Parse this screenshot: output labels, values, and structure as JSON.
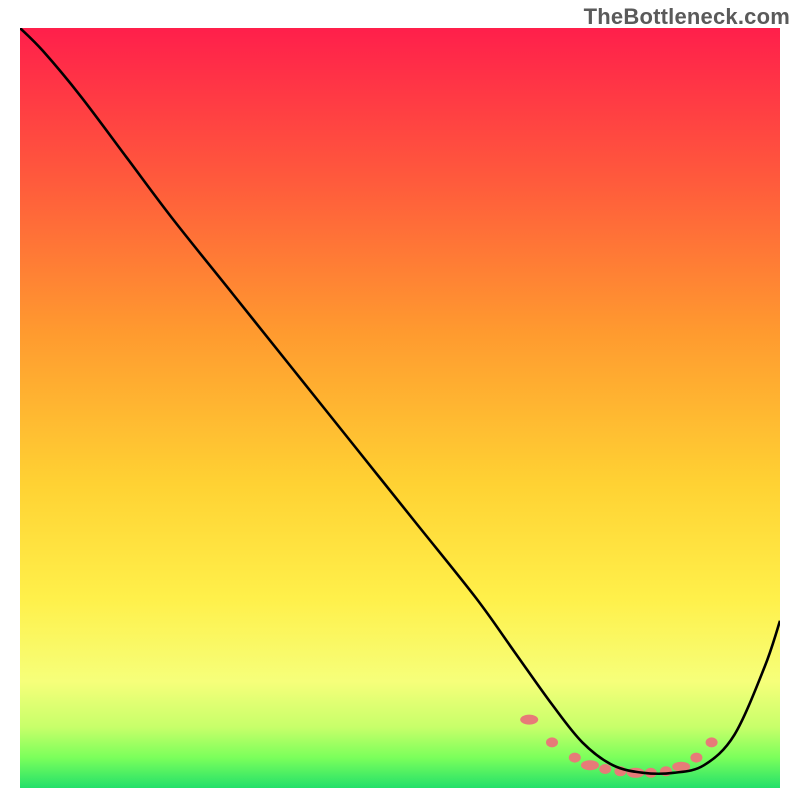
{
  "watermark": "TheBottleneck.com",
  "chart_data": {
    "type": "line",
    "title": "",
    "xlabel": "",
    "ylabel": "",
    "xlim": [
      0,
      100
    ],
    "ylim": [
      0,
      100
    ],
    "grid": false,
    "legend": false,
    "gradient_stops": [
      {
        "offset": 0,
        "color": "#ff1f4b"
      },
      {
        "offset": 20,
        "color": "#ff5a3c"
      },
      {
        "offset": 40,
        "color": "#ff9a2f"
      },
      {
        "offset": 60,
        "color": "#ffd233"
      },
      {
        "offset": 75,
        "color": "#fff04a"
      },
      {
        "offset": 86,
        "color": "#f6ff7a"
      },
      {
        "offset": 92,
        "color": "#c7ff6a"
      },
      {
        "offset": 96,
        "color": "#7bff5b"
      },
      {
        "offset": 100,
        "color": "#23e06a"
      }
    ],
    "series": [
      {
        "name": "bottleneck-curve",
        "color": "#000000",
        "x": [
          0,
          3,
          8,
          14,
          20,
          28,
          36,
          44,
          52,
          60,
          65,
          70,
          74,
          78,
          82,
          86,
          90,
          94,
          98,
          100
        ],
        "y": [
          100,
          97,
          91,
          83,
          75,
          65,
          55,
          45,
          35,
          25,
          18,
          11,
          6,
          3,
          2,
          2,
          3,
          7,
          16,
          22
        ]
      }
    ],
    "markers": {
      "name": "optimal-range",
      "color": "#e77b78",
      "x": [
        67,
        70,
        73,
        75,
        77,
        79,
        81,
        83,
        85,
        87,
        89,
        91
      ],
      "y": [
        9,
        6,
        4,
        3,
        2.5,
        2.2,
        2.0,
        2.0,
        2.2,
        2.8,
        4.0,
        6.0
      ]
    }
  }
}
